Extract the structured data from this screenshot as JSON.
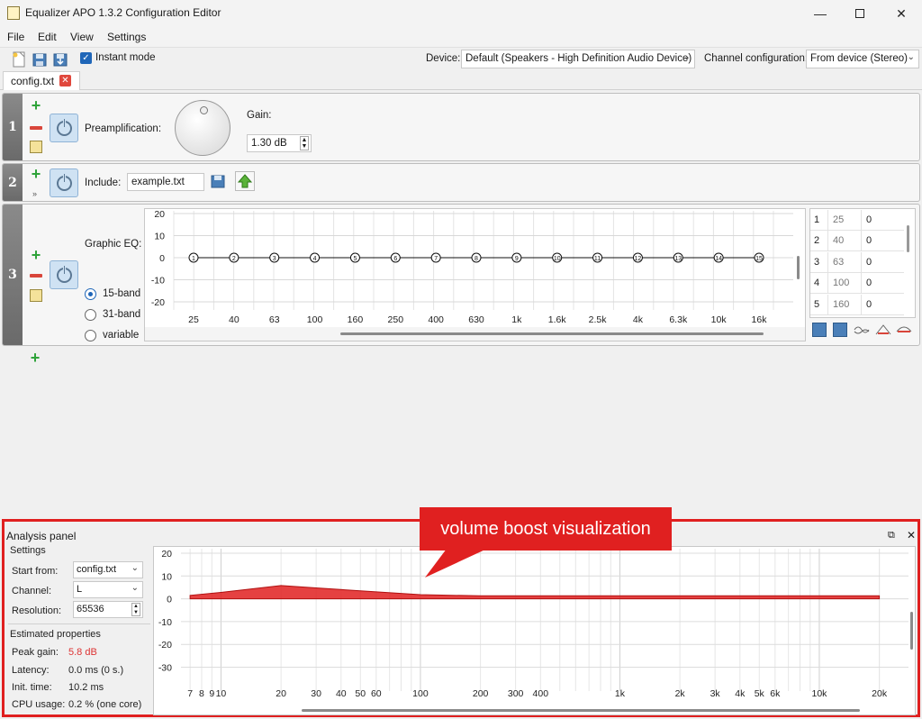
{
  "window": {
    "title": "Equalizer APO 1.3.2 Configuration Editor"
  },
  "menu": [
    "File",
    "Edit",
    "View",
    "Settings"
  ],
  "toolbar": {
    "instant_mode_label": "Instant mode",
    "instant_mode_checked": true,
    "device_label": "Device:",
    "device_value": "Default (Speakers - High Definition Audio Device)",
    "channel_config_label": "Channel configuration:",
    "channel_config_value": "From device (Stereo)"
  },
  "tab": {
    "label": "config.txt"
  },
  "rows": [
    {
      "number": "1",
      "label": "Preamplification:",
      "gain_label": "Gain:",
      "gain_value": "1.30 dB"
    },
    {
      "number": "2",
      "label": "Include:",
      "file_value": "example.txt"
    },
    {
      "number": "3",
      "label": "Graphic EQ:",
      "band_options": [
        "15-band",
        "31-band",
        "variable"
      ],
      "selected_band": "15-band"
    }
  ],
  "eq": {
    "y_ticks": [
      "20",
      "10",
      "0",
      "-10",
      "-20"
    ],
    "x_ticks": [
      "25",
      "40",
      "63",
      "100",
      "160",
      "250",
      "400",
      "630",
      "1k",
      "1.6k",
      "2.5k",
      "4k",
      "6.3k",
      "10k",
      "16k"
    ],
    "bands": [
      "1",
      "2",
      "3",
      "4",
      "5",
      "6",
      "7",
      "8",
      "9",
      "10",
      "11",
      "12",
      "13",
      "14",
      "15"
    ],
    "table": [
      {
        "n": "1",
        "freq": "25",
        "gain": "0"
      },
      {
        "n": "2",
        "freq": "40",
        "gain": "0"
      },
      {
        "n": "3",
        "freq": "63",
        "gain": "0"
      },
      {
        "n": "4",
        "freq": "100",
        "gain": "0"
      },
      {
        "n": "5",
        "freq": "160",
        "gain": "0"
      }
    ]
  },
  "analysis": {
    "title": "Analysis panel",
    "settings_header": "Settings",
    "start_from_label": "Start from:",
    "start_from_value": "config.txt",
    "channel_label": "Channel:",
    "channel_value": "L",
    "resolution_label": "Resolution:",
    "resolution_value": "65536",
    "estimated_header": "Estimated properties",
    "peak_gain_label": "Peak gain:",
    "peak_gain_value": "5.8 dB",
    "latency_label": "Latency:",
    "latency_value": "0.0 ms (0 s.)",
    "init_time_label": "Init. time:",
    "init_time_value": "10.2 ms",
    "cpu_label": "CPU usage:",
    "cpu_value": "0.2 % (one core)",
    "y_ticks": [
      "20",
      "10",
      "0",
      "-10",
      "-20",
      "-30"
    ],
    "x_ticks": [
      "7",
      "8",
      "9",
      "10",
      "20",
      "30",
      "40",
      "50",
      "60",
      "100",
      "200",
      "300",
      "400",
      "1k",
      "2k",
      "3k",
      "4k",
      "5k",
      "6k",
      "10k",
      "20k"
    ],
    "callout": "volume boost visualization"
  },
  "chart_data": {
    "type": "area",
    "x": [
      7,
      10,
      20,
      30,
      50,
      100,
      200,
      1000,
      20000
    ],
    "y": [
      1.5,
      2.8,
      5.8,
      4.8,
      3.5,
      1.8,
      1.3,
      1.3,
      1.3
    ],
    "xscale": "log",
    "ylim": [
      -38,
      22
    ],
    "grid": true,
    "color": "#e02020"
  }
}
